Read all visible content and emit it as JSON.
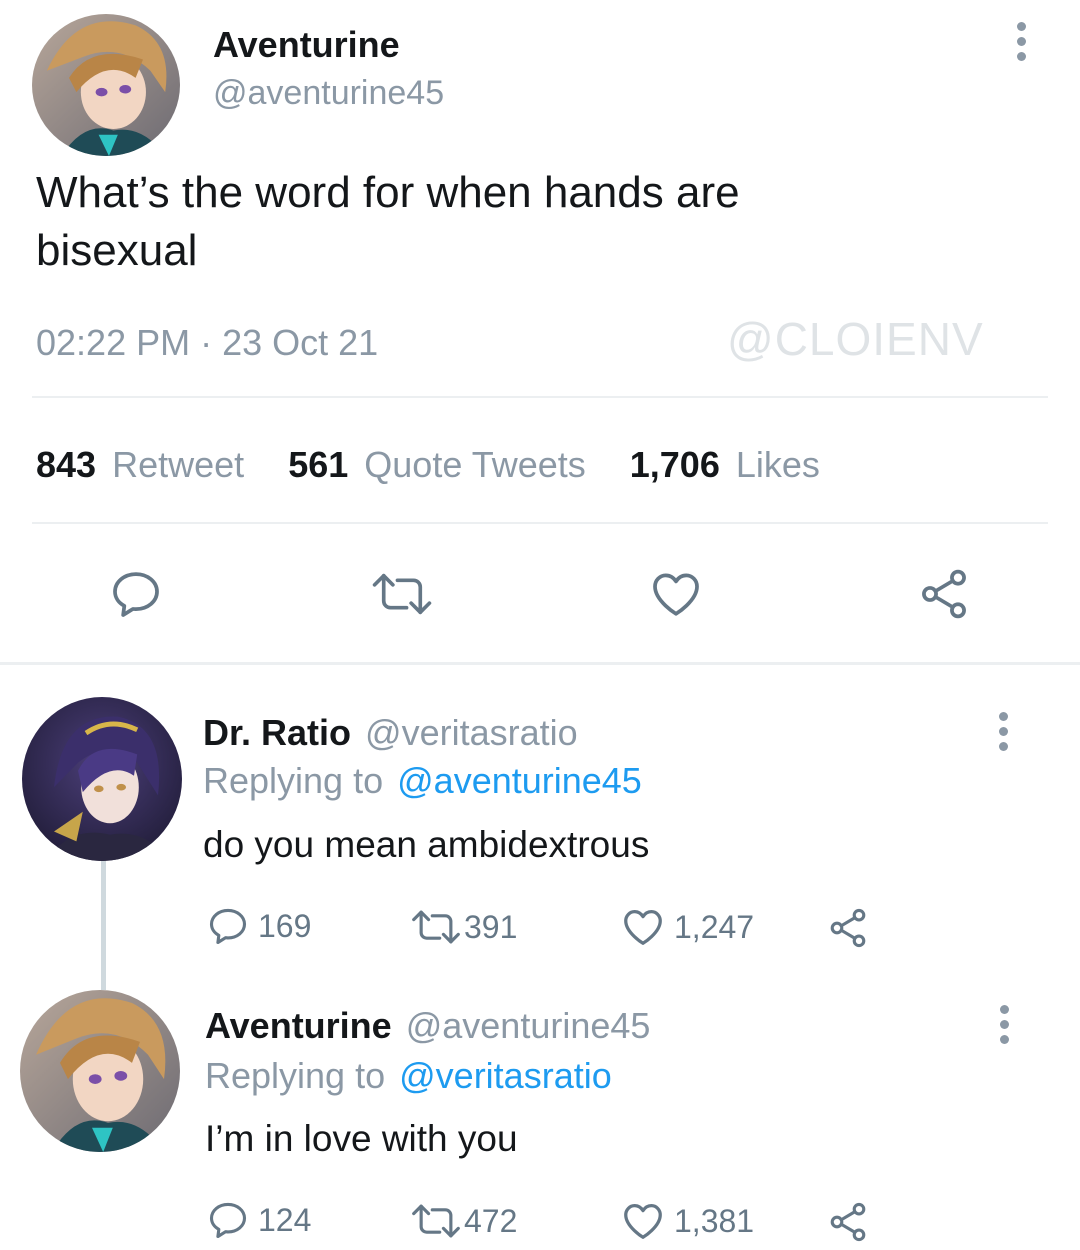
{
  "main_tweet": {
    "author": "Aventurine",
    "handle": "@aventurine45",
    "text_line1": "What’s the word for when hands are",
    "text_line2": "bisexual",
    "timestamp": "02:22 PM · 23 Oct 21",
    "watermark": "@CLOIENV",
    "stats": {
      "retweets_count": "843",
      "retweets_label": "Retweet",
      "quotes_count": "561",
      "quotes_label": "Quote Tweets",
      "likes_count": "1,706",
      "likes_label": "Likes"
    },
    "actions": [
      "reply-icon",
      "retweet-icon",
      "like-icon",
      "share-icon"
    ]
  },
  "replies": [
    {
      "author": "Dr. Ratio",
      "handle": "@veritasratio",
      "replying_prefix": "Replying to",
      "replying_to": "@aventurine45",
      "text": "do you mean ambidextrous",
      "reply_count": "169",
      "retweet_count": "391",
      "like_count": "1,247"
    },
    {
      "author": "Aventurine",
      "handle": "@aventurine45",
      "replying_prefix": "Replying to",
      "replying_to": "@veritasratio",
      "text": "I’m in love with you",
      "reply_count": "124",
      "retweet_count": "472",
      "like_count": "1,381"
    }
  ],
  "colors": {
    "link": "#1d9bf0",
    "muted": "#8b98a5",
    "text": "#14171a",
    "divider": "#eceff1"
  }
}
